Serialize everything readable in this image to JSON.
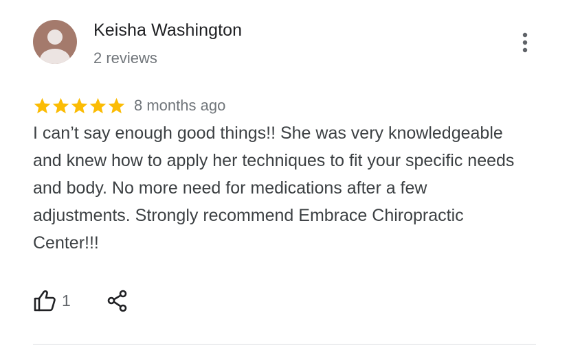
{
  "reviewer": {
    "name": "Keisha Washington",
    "review_count": "2 reviews",
    "avatar_color": "#a47a6c"
  },
  "review": {
    "rating": 5,
    "rating_max": 5,
    "star_color": "#fbbc04",
    "date": "8 months ago",
    "text": "I can’t say enough good things!! She was very knowledgeable and knew how to apply her techniques to fit your specific needs and body. No more need for medications after a few adjustments. Strongly recommend Embrace Chiropractic Center!!!"
  },
  "actions": {
    "like_icon": "thumbs-up-icon",
    "like_count": "1",
    "share_icon": "share-icon",
    "more_icon": "more-vert-icon"
  }
}
